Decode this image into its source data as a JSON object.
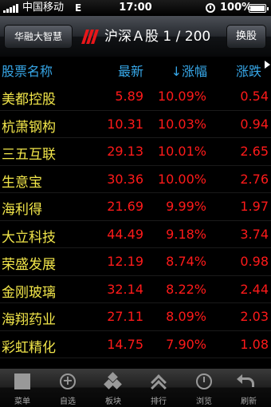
{
  "status_bar": {
    "carrier": "中国移动",
    "network": "E",
    "time": "17:00",
    "battery": "100%"
  },
  "nav": {
    "back_label": "华融大智慧",
    "title": "沪深Ａ股 1 / 200",
    "switch_label": "换股",
    "logo_color": "#e8161a"
  },
  "columns": {
    "name": "股票名称",
    "price": "最新",
    "pct": "↓涨幅",
    "change": "涨跌"
  },
  "stocks": [
    {
      "name": "美都控股",
      "price": "5.89",
      "pct": "10.09%",
      "change": "0.54"
    },
    {
      "name": "杭萧钢构",
      "price": "10.31",
      "pct": "10.03%",
      "change": "0.94"
    },
    {
      "name": "三五互联",
      "price": "29.13",
      "pct": "10.01%",
      "change": "2.65"
    },
    {
      "name": "生意宝",
      "price": "30.36",
      "pct": "10.00%",
      "change": "2.76"
    },
    {
      "name": "海利得",
      "price": "21.69",
      "pct": "9.99%",
      "change": "1.97"
    },
    {
      "name": "大立科技",
      "price": "44.49",
      "pct": "9.18%",
      "change": "3.74"
    },
    {
      "name": "荣盛发展",
      "price": "12.19",
      "pct": "8.74%",
      "change": "0.98"
    },
    {
      "name": "金刚玻璃",
      "price": "32.14",
      "pct": "8.22%",
      "change": "2.44"
    },
    {
      "name": "海翔药业",
      "price": "27.11",
      "pct": "8.09%",
      "change": "2.03"
    },
    {
      "name": "彩虹精化",
      "price": "14.75",
      "pct": "7.90%",
      "change": "1.08"
    }
  ],
  "tabs": [
    {
      "label": "菜单",
      "icon": "menu-icon"
    },
    {
      "label": "自选",
      "icon": "add-circle-icon"
    },
    {
      "label": "板块",
      "icon": "sector-icon"
    },
    {
      "label": "排行",
      "icon": "ranking-icon"
    },
    {
      "label": "浏览",
      "icon": "browse-icon"
    },
    {
      "label": "刷新",
      "icon": "refresh-icon"
    }
  ],
  "colors": {
    "stock_name": "#f2e64a",
    "rising": "#ff1a1a",
    "header": "#37a7e8"
  }
}
